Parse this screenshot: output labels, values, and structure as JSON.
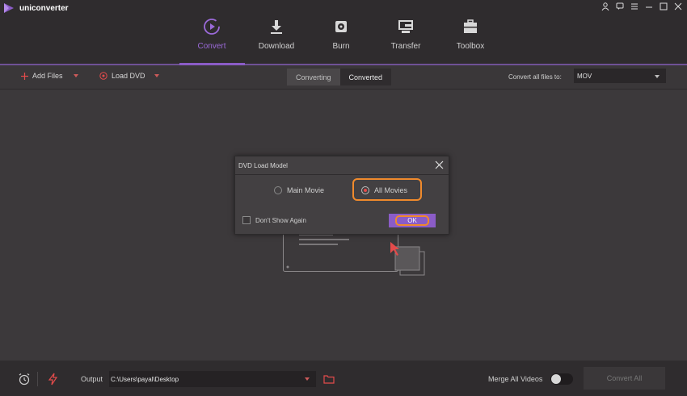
{
  "app": {
    "name": "uniconverter"
  },
  "colors": {
    "accent": "#8b5cc7",
    "highlight": "#f08a2c",
    "red_icon": "#e34b4b"
  },
  "nav": {
    "items": [
      {
        "label": "Convert",
        "icon": "convert-icon",
        "active": true
      },
      {
        "label": "Download",
        "icon": "download-icon"
      },
      {
        "label": "Burn",
        "icon": "burn-icon"
      },
      {
        "label": "Transfer",
        "icon": "transfer-icon"
      },
      {
        "label": "Toolbox",
        "icon": "toolbox-icon"
      }
    ]
  },
  "toolbar": {
    "add_files": "Add Files",
    "load_dvd": "Load DVD",
    "tab_converting": "Converting",
    "tab_converted": "Converted",
    "convert_all_label": "Convert all files to:",
    "format_value": "MOV"
  },
  "dialog": {
    "title": "DVD Load Model",
    "option_main": "Main Movie",
    "option_all": "All Movies",
    "selected": "All Movies",
    "dont_show": "Don't Show Again",
    "ok": "OK"
  },
  "bottom": {
    "output_label": "Output",
    "output_path": "C:\\Users\\payal\\Desktop",
    "merge_label": "Merge All Videos",
    "convert_all": "Convert All"
  }
}
